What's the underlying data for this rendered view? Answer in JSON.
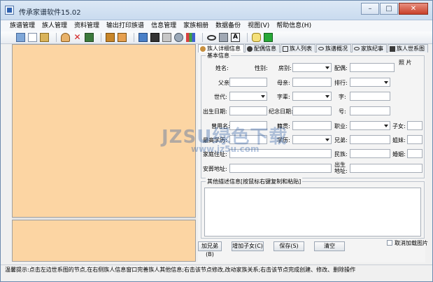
{
  "window": {
    "title": "传承家谱软件15.02"
  },
  "menu": [
    "族谱管理",
    "族人管理",
    "资料管理",
    "输出打印族谱",
    "信息管理",
    "家族相册",
    "数据备份",
    "视图(V)",
    "帮助信息(H)"
  ],
  "tabs": [
    {
      "label": "族人详细信息",
      "icon": "person-icon"
    },
    {
      "label": "配偶信息",
      "icon": "person-icon"
    },
    {
      "label": "族人列表",
      "icon": "list-icon"
    },
    {
      "label": "族谱概况",
      "icon": "glasses-icon"
    },
    {
      "label": "家族纪事",
      "icon": "glasses-icon"
    },
    {
      "label": "族人世系图",
      "icon": "tree-icon"
    }
  ],
  "basic_info": {
    "title": "基本信息",
    "labels": {
      "name": "姓名:",
      "gender": "性别:",
      "branch": "房别:",
      "spouse": "配偶:",
      "photo": "照  片",
      "father": "父亲:",
      "mother": "母亲:",
      "rank": "排行:",
      "generation": "世代:",
      "generation_char": "字辈:",
      "courtesy": "字:",
      "birth_date": "出生日期:",
      "memorial_date": "纪念日期:",
      "alias": "号:",
      "former_name": "曾用名:",
      "origin": "籍贯:",
      "occupation": "职业:",
      "children": "子女:",
      "qualification": "最高学历:",
      "education": "学历:",
      "siblings": "兄弟:",
      "sisters": "姐妹:",
      "address": "家庭住址:",
      "ethnicity": "民族:",
      "marriage": "婚姻:",
      "burial": "安葬地址:",
      "birthplace": "出生地址:"
    }
  },
  "other_info": {
    "title": "其他描述信息[按鼠标右键复制和粘贴]"
  },
  "buttons": {
    "add_sibling": "加兄弟(B)",
    "add_child": "增加子女(C)",
    "save": "保存(S)",
    "clear": "清空"
  },
  "checkbox": {
    "cancel_image": "取消加载图片"
  },
  "status": "温馨提示:点击左边世系图的节点,在右侧族人信息窗口完善族人其他信息;右击该节点修改,改动家族关系;右击该节点完成创建、修改、删除操作",
  "watermark": {
    "brand": "JZSU绿色下载",
    "url": "www.jz5u.com"
  },
  "colors": {
    "tree_bg": "#fcd5a3",
    "title_bar": "#c9dbef"
  }
}
